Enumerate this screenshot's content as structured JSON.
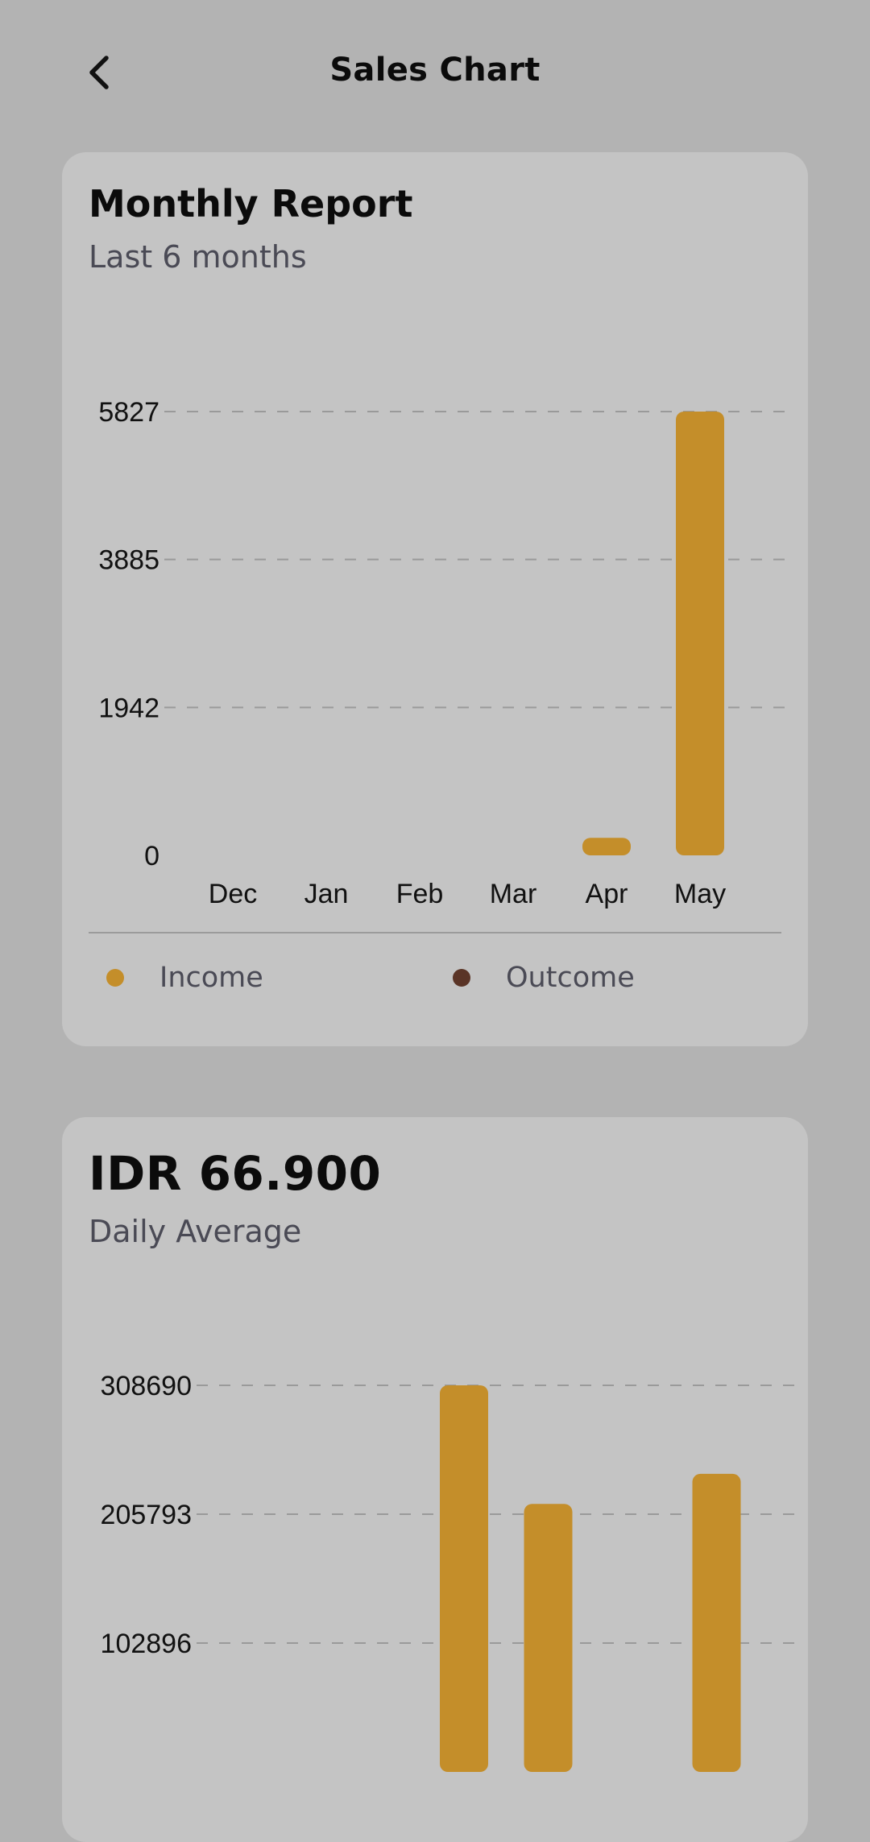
{
  "header": {
    "title": "Sales Chart",
    "back_icon": "chevron-left-icon"
  },
  "colors": {
    "background": "#b3b3b3",
    "card": "#c4c4c4",
    "income": "#c48e2a",
    "outcome": "#5a3426",
    "gridline": "#9a9a9a"
  },
  "monthly_report": {
    "title": "Monthly Report",
    "subtitle": "Last 6 months",
    "legend": [
      {
        "label": "Income",
        "color": "#c48e2a"
      },
      {
        "label": "Outcome",
        "color": "#5a3426"
      }
    ]
  },
  "daily_average": {
    "title": "IDR 66.900",
    "subtitle": "Daily Average"
  },
  "chart_data": [
    {
      "type": "bar",
      "title": "Monthly Report",
      "subtitle": "Last 6 months",
      "categories": [
        "Dec",
        "Jan",
        "Feb",
        "Mar",
        "Apr",
        "May"
      ],
      "series": [
        {
          "name": "Income",
          "values": [
            0,
            0,
            0,
            0,
            230,
            5827
          ]
        }
      ],
      "yticks": [
        0,
        1942,
        3885,
        5827
      ],
      "ylim": [
        0,
        5827
      ],
      "grid": true
    },
    {
      "type": "bar",
      "title": "IDR 66.900",
      "subtitle": "Daily Average",
      "series": [
        {
          "values": [
            0,
            0,
            308690,
            214000,
            0,
            238000,
            0
          ]
        }
      ],
      "yticks": [
        102896,
        205793,
        308690
      ],
      "ylim": [
        0,
        308690
      ],
      "grid": true
    }
  ]
}
